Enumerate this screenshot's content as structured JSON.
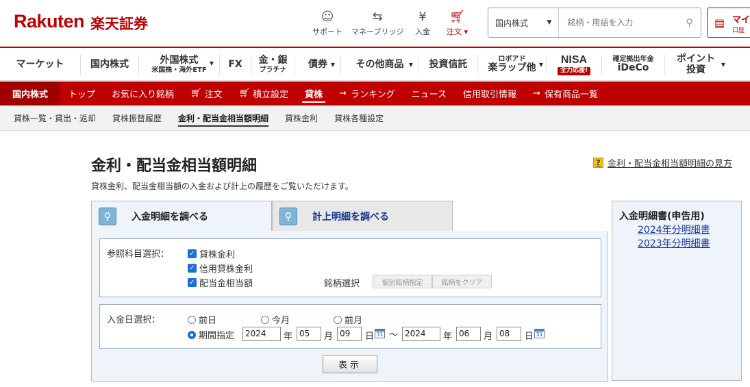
{
  "header": {
    "logo": "Rakuten",
    "logo_jp": "楽天証券",
    "icons": [
      {
        "name": "support-icon",
        "label": "サポート"
      },
      {
        "name": "bank-icon",
        "label": "マネーブリッジ"
      },
      {
        "name": "deposit-icon",
        "label": "入金"
      },
      {
        "name": "cart-icon",
        "label": "注文 ▾"
      }
    ],
    "search": {
      "category": "国内株式",
      "placeholder": "銘柄・用語を入力"
    },
    "mypage": {
      "title": "マイ",
      "sub": "口座"
    }
  },
  "global_nav": [
    {
      "label": "マーケット",
      "sub": "",
      "caret": false
    },
    {
      "label": "国内株式",
      "sub": "",
      "caret": false
    },
    {
      "label": "外国株式",
      "sub": "米国株・海外ETF",
      "caret": true
    },
    {
      "label": "FX",
      "sub": "",
      "caret": false
    },
    {
      "label": "金・銀",
      "sub": "プラチナ",
      "caret": false
    },
    {
      "label": "債券",
      "sub": "",
      "caret": true
    },
    {
      "label": "その他商品",
      "sub": "",
      "caret": true
    },
    {
      "label": "投資信託",
      "sub": "",
      "caret": false
    },
    {
      "label": "楽ラップ他",
      "top": "ロボアド",
      "caret": true
    },
    {
      "label": "NISA",
      "badge": "全力応援!",
      "caret": false
    },
    {
      "label": "iDeCo",
      "top": "確定拠出年金",
      "caret": false
    },
    {
      "label": "ポイント",
      "sub": "投資",
      "caret": true
    }
  ],
  "red_nav": {
    "section": "国内株式",
    "items": [
      "トップ",
      "お気に入り銘柄",
      "注文",
      "積立設定",
      "貸株",
      "ランキング",
      "ニュース",
      "信用取引情報",
      "保有商品一覧"
    ],
    "active": "貸株"
  },
  "sub_nav": {
    "items": [
      "貸株一覧・貸出・返却",
      "貸株振替履歴",
      "金利・配当金相当額明細",
      "貸株金利",
      "貸株各種設定"
    ],
    "active": "金利・配当金相当額明細"
  },
  "main": {
    "title": "金利・配当金相当額明細",
    "help_link": "金利・配当金相当額明細の見方",
    "description": "貸株金利、配当金相当額の入金および計上の履歴をご覧いただけます。",
    "tabs": [
      "入金明細を調べる",
      "計上明細を調べる"
    ],
    "form": {
      "subject_label": "参照科目選択：",
      "checkboxes": [
        "貸株金利",
        "信用貸株金利",
        "配当金相当額"
      ],
      "meigara_label": "銘柄選択",
      "meigara_btn1": "個別銘柄指定",
      "meigara_btn2": "銘柄をクリア",
      "date_label": "入金日選択：",
      "radios": [
        "前日",
        "今月",
        "前月",
        "期間指定"
      ],
      "selected_radio": "期間指定",
      "from": {
        "year": "2024",
        "month": "05",
        "day": "09"
      },
      "to": {
        "year": "2024",
        "month": "06",
        "day": "08"
      },
      "unit_year": "年",
      "unit_month": "月",
      "unit_day": "日",
      "range_sep": "〜",
      "cal_text": "31",
      "submit": "表示"
    }
  },
  "sidebar": {
    "title": "入金明細書(申告用)",
    "links": [
      "2024年分明細書",
      "2023年分明細書"
    ]
  },
  "colors": {
    "brand": "#bf0000",
    "link": "#1a3a9a",
    "panel": "#eef4fa"
  }
}
